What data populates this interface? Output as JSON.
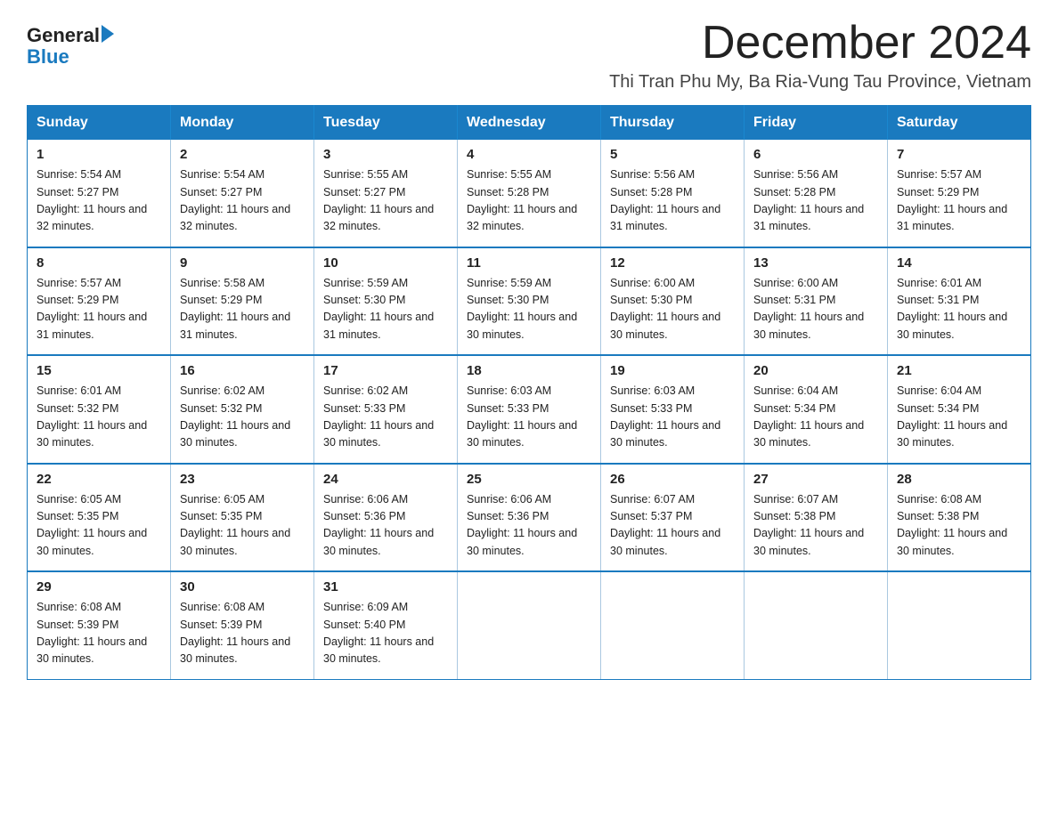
{
  "logo": {
    "general": "General",
    "blue": "Blue"
  },
  "title": "December 2024",
  "location": "Thi Tran Phu My, Ba Ria-Vung Tau Province, Vietnam",
  "days_of_week": [
    "Sunday",
    "Monday",
    "Tuesday",
    "Wednesday",
    "Thursday",
    "Friday",
    "Saturday"
  ],
  "weeks": [
    [
      {
        "day": "1",
        "sunrise": "5:54 AM",
        "sunset": "5:27 PM",
        "daylight": "11 hours and 32 minutes."
      },
      {
        "day": "2",
        "sunrise": "5:54 AM",
        "sunset": "5:27 PM",
        "daylight": "11 hours and 32 minutes."
      },
      {
        "day": "3",
        "sunrise": "5:55 AM",
        "sunset": "5:27 PM",
        "daylight": "11 hours and 32 minutes."
      },
      {
        "day": "4",
        "sunrise": "5:55 AM",
        "sunset": "5:28 PM",
        "daylight": "11 hours and 32 minutes."
      },
      {
        "day": "5",
        "sunrise": "5:56 AM",
        "sunset": "5:28 PM",
        "daylight": "11 hours and 31 minutes."
      },
      {
        "day": "6",
        "sunrise": "5:56 AM",
        "sunset": "5:28 PM",
        "daylight": "11 hours and 31 minutes."
      },
      {
        "day": "7",
        "sunrise": "5:57 AM",
        "sunset": "5:29 PM",
        "daylight": "11 hours and 31 minutes."
      }
    ],
    [
      {
        "day": "8",
        "sunrise": "5:57 AM",
        "sunset": "5:29 PM",
        "daylight": "11 hours and 31 minutes."
      },
      {
        "day": "9",
        "sunrise": "5:58 AM",
        "sunset": "5:29 PM",
        "daylight": "11 hours and 31 minutes."
      },
      {
        "day": "10",
        "sunrise": "5:59 AM",
        "sunset": "5:30 PM",
        "daylight": "11 hours and 31 minutes."
      },
      {
        "day": "11",
        "sunrise": "5:59 AM",
        "sunset": "5:30 PM",
        "daylight": "11 hours and 30 minutes."
      },
      {
        "day": "12",
        "sunrise": "6:00 AM",
        "sunset": "5:30 PM",
        "daylight": "11 hours and 30 minutes."
      },
      {
        "day": "13",
        "sunrise": "6:00 AM",
        "sunset": "5:31 PM",
        "daylight": "11 hours and 30 minutes."
      },
      {
        "day": "14",
        "sunrise": "6:01 AM",
        "sunset": "5:31 PM",
        "daylight": "11 hours and 30 minutes."
      }
    ],
    [
      {
        "day": "15",
        "sunrise": "6:01 AM",
        "sunset": "5:32 PM",
        "daylight": "11 hours and 30 minutes."
      },
      {
        "day": "16",
        "sunrise": "6:02 AM",
        "sunset": "5:32 PM",
        "daylight": "11 hours and 30 minutes."
      },
      {
        "day": "17",
        "sunrise": "6:02 AM",
        "sunset": "5:33 PM",
        "daylight": "11 hours and 30 minutes."
      },
      {
        "day": "18",
        "sunrise": "6:03 AM",
        "sunset": "5:33 PM",
        "daylight": "11 hours and 30 minutes."
      },
      {
        "day": "19",
        "sunrise": "6:03 AM",
        "sunset": "5:33 PM",
        "daylight": "11 hours and 30 minutes."
      },
      {
        "day": "20",
        "sunrise": "6:04 AM",
        "sunset": "5:34 PM",
        "daylight": "11 hours and 30 minutes."
      },
      {
        "day": "21",
        "sunrise": "6:04 AM",
        "sunset": "5:34 PM",
        "daylight": "11 hours and 30 minutes."
      }
    ],
    [
      {
        "day": "22",
        "sunrise": "6:05 AM",
        "sunset": "5:35 PM",
        "daylight": "11 hours and 30 minutes."
      },
      {
        "day": "23",
        "sunrise": "6:05 AM",
        "sunset": "5:35 PM",
        "daylight": "11 hours and 30 minutes."
      },
      {
        "day": "24",
        "sunrise": "6:06 AM",
        "sunset": "5:36 PM",
        "daylight": "11 hours and 30 minutes."
      },
      {
        "day": "25",
        "sunrise": "6:06 AM",
        "sunset": "5:36 PM",
        "daylight": "11 hours and 30 minutes."
      },
      {
        "day": "26",
        "sunrise": "6:07 AM",
        "sunset": "5:37 PM",
        "daylight": "11 hours and 30 minutes."
      },
      {
        "day": "27",
        "sunrise": "6:07 AM",
        "sunset": "5:38 PM",
        "daylight": "11 hours and 30 minutes."
      },
      {
        "day": "28",
        "sunrise": "6:08 AM",
        "sunset": "5:38 PM",
        "daylight": "11 hours and 30 minutes."
      }
    ],
    [
      {
        "day": "29",
        "sunrise": "6:08 AM",
        "sunset": "5:39 PM",
        "daylight": "11 hours and 30 minutes."
      },
      {
        "day": "30",
        "sunrise": "6:08 AM",
        "sunset": "5:39 PM",
        "daylight": "11 hours and 30 minutes."
      },
      {
        "day": "31",
        "sunrise": "6:09 AM",
        "sunset": "5:40 PM",
        "daylight": "11 hours and 30 minutes."
      },
      null,
      null,
      null,
      null
    ]
  ]
}
